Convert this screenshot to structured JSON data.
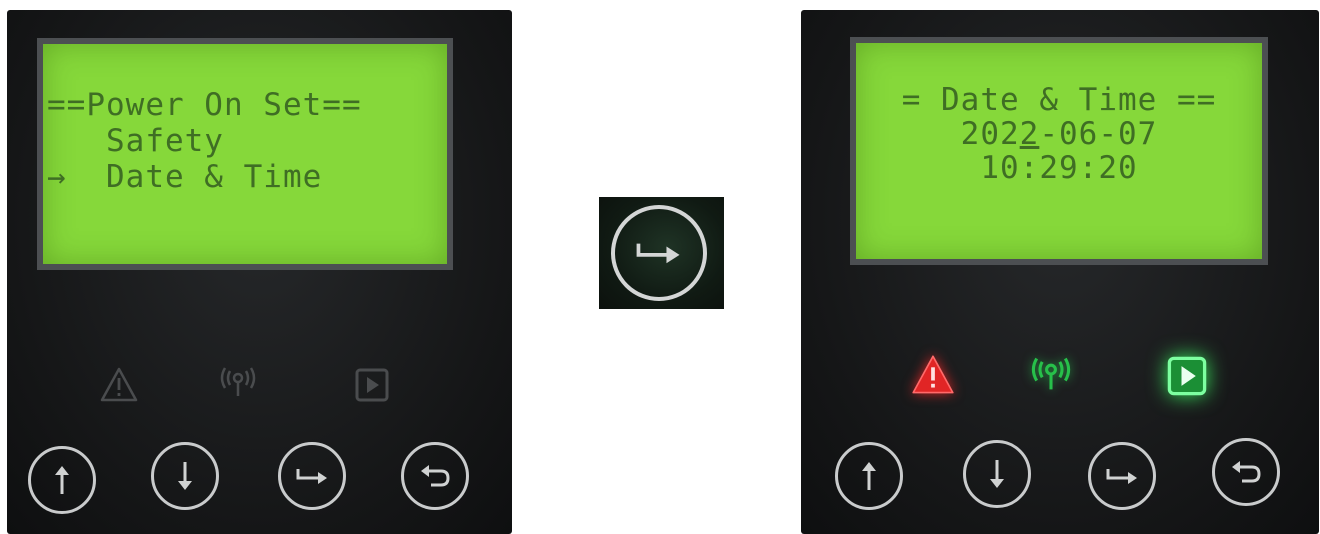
{
  "left_panel": {
    "lcd_lines": [
      "==Power On Set==",
      "   Safety",
      "→  Date & Time"
    ],
    "indicators": {
      "warning": "warning-triangle-icon",
      "signal": "signal-icon",
      "play": "play-icon"
    },
    "indicator_state": "off",
    "buttons": [
      "arrow-up-icon",
      "arrow-down-icon",
      "enter-icon",
      "back-icon"
    ]
  },
  "center_key": {
    "icon": "enter-icon"
  },
  "right_panel": {
    "lcd_title": "= Date & Time ==",
    "date": {
      "before": "202",
      "cursor": "2",
      "after": "-06-07"
    },
    "time": "10:29:20",
    "indicators": {
      "warning": "warning-triangle-icon",
      "signal": "signal-icon",
      "play": "play-icon"
    },
    "indicator_state": "on",
    "buttons": [
      "arrow-up-icon",
      "arrow-down-icon",
      "enter-icon",
      "back-icon"
    ]
  },
  "colors": {
    "lcd_bg": "#86d83a",
    "lcd_text": "#3f6e24",
    "warning_on": "#e12525",
    "signal_on": "#27c04a",
    "play_on": "#35e05a",
    "indicator_off": "#4a4c4e",
    "button_ring": "#c9cbcc"
  }
}
